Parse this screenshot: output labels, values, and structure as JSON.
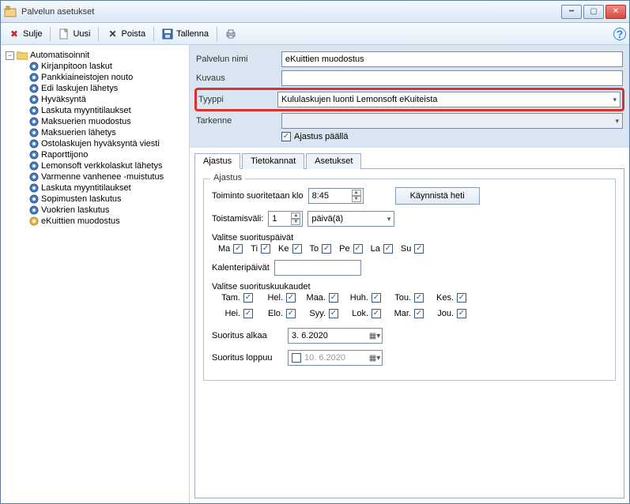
{
  "window": {
    "title": "Palvelun asetukset"
  },
  "toolbar": {
    "close": "Sulje",
    "new": "Uusi",
    "delete": "Poista",
    "save": "Tallenna"
  },
  "tree": {
    "root": "Automatisoinnit",
    "items": [
      "Kirjanpitoon laskut",
      "Pankkiaineistojen nouto",
      "Edi laskujen lähetys",
      "Hyväksyntä",
      "Laskuta myyntitilaukset",
      "Maksuerien muodostus",
      "Maksuerien lähetys",
      "Ostolaskujen hyväksyntä viesti",
      "Raporttijono",
      "Lemonsoft verkkolaskut lähetys",
      "Varmenne vanhenee -muistutus",
      "Laskuta myyntitilaukset",
      "Sopimusten laskutus",
      "Vuokrien laskutus",
      "eKuittien muodostus"
    ],
    "selectedIndex": 14
  },
  "form": {
    "name_label": "Palvelun nimi",
    "name_value": "eKuittien muodostus",
    "desc_label": "Kuvaus",
    "desc_value": "",
    "type_label": "Tyyppi",
    "type_value": "Kululaskujen luonti Lemonsoft eKuiteista",
    "spec_label": "Tarkenne",
    "spec_value": "",
    "timer_label": "Ajastus päällä",
    "timer_checked": true
  },
  "tabs": {
    "t1": "Ajastus",
    "t2": "Tietokannat",
    "t3": "Asetukset"
  },
  "ajastus": {
    "legend": "Ajastus",
    "run_at_label": "Toiminto suoritetaan klo",
    "run_at_value": "8:45",
    "run_now": "Käynnistä heti",
    "interval_label": "Toistamisväli:",
    "interval_value": "1",
    "interval_unit": "päivä(ä)",
    "days_header": "Valitse suorituspäivät",
    "days": [
      "Ma",
      "Ti",
      "Ke",
      "To",
      "Pe",
      "La",
      "Su"
    ],
    "calendar_label": "Kalenteripäivät",
    "calendar_value": "",
    "months_header": "Valitse suorituskuukaudet",
    "months_r1": [
      "Tam.",
      "Hel.",
      "Maa.",
      "Huh.",
      "Tou.",
      "Kes."
    ],
    "months_r2": [
      "Hei.",
      "Elo.",
      "Syy.",
      "Lok.",
      "Mar.",
      "Jou."
    ],
    "start_label": "Suoritus alkaa",
    "start_value": " 3.  6.2020",
    "end_label": "Suoritus loppuu",
    "end_value": "10.  6.2020",
    "end_enabled": false
  }
}
